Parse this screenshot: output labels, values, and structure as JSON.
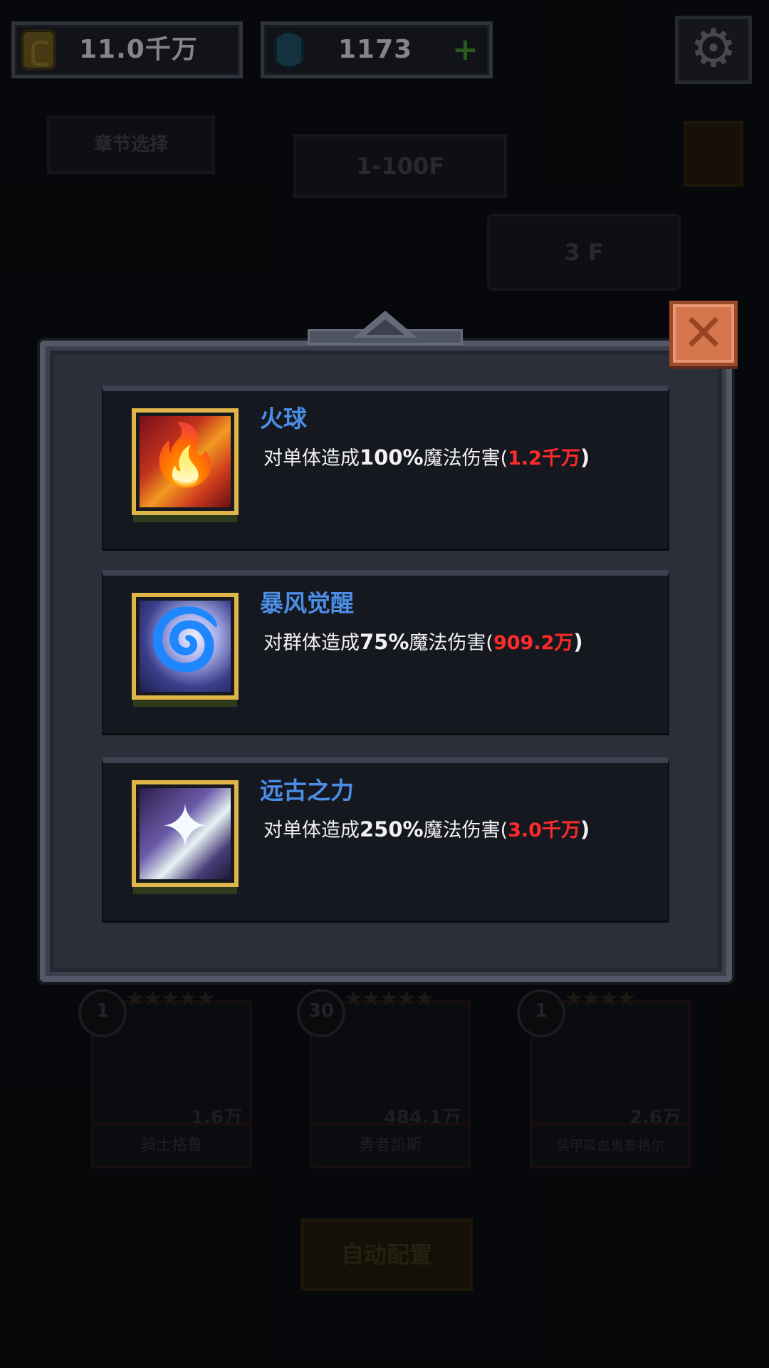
{
  "top_bar": {
    "gold": "11.0千万",
    "gems": "1173",
    "gems_add": "+",
    "settings_icon": "gear-icon"
  },
  "background": {
    "chapter_select": "章节选择",
    "floor_range": "1-100F",
    "locked_floor": "3  F",
    "heroes": [
      {
        "level": "1",
        "name": "骑士格鲁",
        "power": "1.6万"
      },
      {
        "level": "30",
        "name": "勇者凯斯",
        "power": "484.1万"
      },
      {
        "level": "1",
        "name": "装甲吸血鬼泰格尔",
        "power": "2.6万"
      }
    ],
    "auto_config": "自动配置"
  },
  "modal": {
    "close_icon": "close-icon",
    "skills": [
      {
        "name": "火球",
        "icon": "fireball-icon",
        "desc_prefix": "对单体造成",
        "percent": "100%",
        "desc_mid": "魔法伤害(",
        "damage": "1.2千万",
        "desc_suffix": ")"
      },
      {
        "name": "暴风觉醒",
        "icon": "storm-icon",
        "desc_prefix": "对群体造成",
        "percent": "75%",
        "desc_mid": "魔法伤害(",
        "damage": "909.2万",
        "desc_suffix": ")"
      },
      {
        "name": "远古之力",
        "icon": "ancient-power-icon",
        "desc_prefix": "对单体造成",
        "percent": "250%",
        "desc_mid": "魔法伤害(",
        "damage": "3.0千万",
        "desc_suffix": ")"
      }
    ]
  },
  "colors": {
    "skill_name": "#4b8ee6",
    "damage": "#ff2a2a",
    "icon_frame": "#e0b64a",
    "close_button": "#d6764f"
  }
}
